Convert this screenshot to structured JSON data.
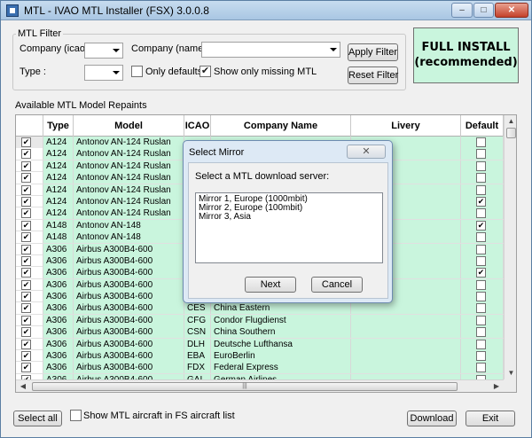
{
  "window": {
    "title": "MTL - IVAO MTL Installer (FSX) 3.0.0.8",
    "controls": {
      "minimize": "–",
      "maximize": "□",
      "close": "✕"
    }
  },
  "filter": {
    "group_label": "MTL Filter",
    "company_icao_label": "Company (icao) :",
    "company_name_label": "Company (name) :",
    "type_label": "Type :",
    "only_defaults_label": "Only defaults",
    "only_defaults_checked": false,
    "show_only_missing_label": "Show only missing MTL",
    "show_only_missing_checked": true,
    "apply_label": "Apply Filter",
    "reset_label": "Reset Filter"
  },
  "full_install": {
    "line1": "FULL INSTALL",
    "line2": "(recommended)"
  },
  "table": {
    "section_label": "Available MTL Model Repaints",
    "headers": [
      "",
      "Type",
      "Model",
      "ICAO",
      "Company Name",
      "Livery",
      "Default"
    ],
    "rows": [
      {
        "checked": true,
        "type": "A124",
        "model": "Antonov AN-124 Ruslan",
        "icao": "",
        "company": "",
        "default": false
      },
      {
        "checked": true,
        "type": "A124",
        "model": "Antonov AN-124 Ruslan",
        "icao": "",
        "company": "",
        "default": false
      },
      {
        "checked": true,
        "type": "A124",
        "model": "Antonov AN-124 Ruslan",
        "icao": "",
        "company": "",
        "default": false
      },
      {
        "checked": true,
        "type": "A124",
        "model": "Antonov AN-124 Ruslan",
        "icao": "",
        "company": "",
        "default": false
      },
      {
        "checked": true,
        "type": "A124",
        "model": "Antonov AN-124 Ruslan",
        "icao": "",
        "company": "",
        "default": false
      },
      {
        "checked": true,
        "type": "A124",
        "model": "Antonov AN-124 Ruslan",
        "icao": "",
        "company": "",
        "default": true
      },
      {
        "checked": true,
        "type": "A124",
        "model": "Antonov AN-124 Ruslan",
        "icao": "",
        "company": "",
        "default": false
      },
      {
        "checked": true,
        "type": "A148",
        "model": "Antonov AN-148",
        "icao": "",
        "company": "",
        "default": true
      },
      {
        "checked": true,
        "type": "A148",
        "model": "Antonov AN-148",
        "icao": "",
        "company": "",
        "default": false
      },
      {
        "checked": true,
        "type": "A306",
        "model": "Airbus A300B4-600",
        "icao": "",
        "company": "",
        "default": false
      },
      {
        "checked": true,
        "type": "A306",
        "model": "Airbus A300B4-600",
        "icao": "",
        "company": "",
        "default": false
      },
      {
        "checked": true,
        "type": "A306",
        "model": "Airbus A300B4-600",
        "icao": "",
        "company": "",
        "default": true
      },
      {
        "checked": true,
        "type": "A306",
        "model": "Airbus A300B4-600",
        "icao": "",
        "company": "",
        "default": false
      },
      {
        "checked": true,
        "type": "A306",
        "model": "Airbus A300B4-600",
        "icao": "",
        "company": "",
        "default": false
      },
      {
        "checked": true,
        "type": "A306",
        "model": "Airbus A300B4-600",
        "icao": "CES",
        "company": "China Eastern",
        "default": false
      },
      {
        "checked": true,
        "type": "A306",
        "model": "Airbus A300B4-600",
        "icao": "CFG",
        "company": "Condor Flugdienst",
        "default": false
      },
      {
        "checked": true,
        "type": "A306",
        "model": "Airbus A300B4-600",
        "icao": "CSN",
        "company": "China Southern",
        "default": false
      },
      {
        "checked": true,
        "type": "A306",
        "model": "Airbus A300B4-600",
        "icao": "DLH",
        "company": "Deutsche Lufthansa",
        "default": false
      },
      {
        "checked": true,
        "type": "A306",
        "model": "Airbus A300B4-600",
        "icao": "EBA",
        "company": "EuroBerlin",
        "default": false
      },
      {
        "checked": true,
        "type": "A306",
        "model": "Airbus A300B4-600",
        "icao": "FDX",
        "company": "Federal Express",
        "default": false
      },
      {
        "checked": true,
        "type": "A306",
        "model": "Airbus A300B4-600",
        "icao": "GAI",
        "company": "German Airlines",
        "default": false
      }
    ]
  },
  "bottom": {
    "select_all_label": "Select all",
    "show_in_fs_label": "Show MTL aircraft in FS aircraft list",
    "show_in_fs_checked": false,
    "download_label": "Download",
    "exit_label": "Exit"
  },
  "dialog": {
    "title": "Select Mirror",
    "close_label": "✕",
    "prompt": "Select a MTL download server:",
    "options": [
      "Mirror 1, Europe (1000mbit)",
      "Mirror 2, Europe (100mbit)",
      "Mirror 3, Asia"
    ],
    "next_label": "Next",
    "cancel_label": "Cancel"
  },
  "colors": {
    "accent_green": "#c9f5dd",
    "title_bar": "#b8d1ea"
  }
}
